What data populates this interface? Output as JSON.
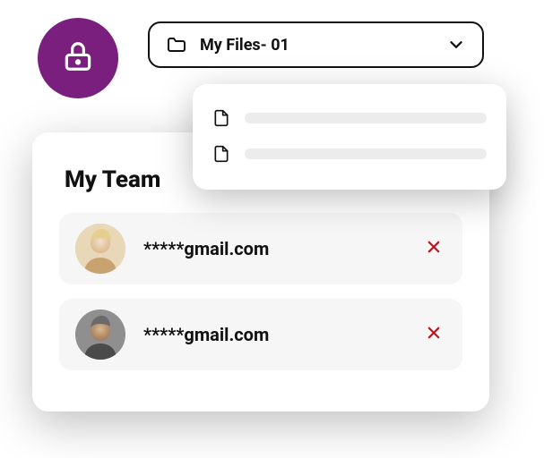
{
  "colors": {
    "accent_purple": "#7a1f7e",
    "danger_red": "#c1121f"
  },
  "lock_badge": {
    "icon": "lock-icon"
  },
  "folder_select": {
    "icon": "folder-icon",
    "label": "My Files- 01",
    "chevron": "chevron-down-icon"
  },
  "dropdown": {
    "items": [
      {
        "icon": "document-icon"
      },
      {
        "icon": "document-icon"
      }
    ]
  },
  "team": {
    "title": "My Team",
    "members": [
      {
        "email_masked": "*****gmail.com",
        "remove_icon": "close-icon"
      },
      {
        "email_masked": "*****gmail.com",
        "remove_icon": "close-icon"
      }
    ]
  }
}
